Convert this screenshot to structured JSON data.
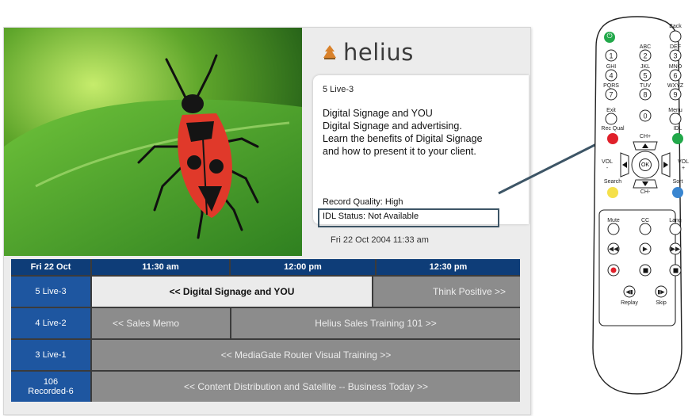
{
  "brand": {
    "name": "helius"
  },
  "info": {
    "channel": "5 Live-3",
    "description": "Digital Signage and YOU\nDigital Signage and advertising.\nLearn the benefits of Digital Signage\nand how to present it to your client.",
    "record_quality": "Record Quality: High",
    "idl_status": "IDL Status:  Not Available",
    "datetime": "Fri  22 Oct 2004  11:33 am"
  },
  "guide": {
    "header": [
      "Fri 22 Oct",
      "11:30 am",
      "12:00 pm",
      "12:30 pm"
    ],
    "rows": [
      {
        "channel": "5 Live-3",
        "programs": [
          "<< Digital Signage and YOU",
          "Think Positive >>"
        ]
      },
      {
        "channel": "4 Live-2",
        "programs": [
          "<< Sales Memo",
          "Helius Sales Training 101 >>"
        ]
      },
      {
        "channel": "3 Live-1",
        "programs": [
          "<< MediaGate Router Visual Training >>"
        ]
      },
      {
        "channel": "106\nRecorded-6",
        "programs": [
          "<< Content Distribution and Satellite --  Business Today >>"
        ]
      }
    ]
  },
  "remote": {
    "top_labels": {
      "back": "Back",
      "power_icon": "power-icon"
    },
    "number_pad": [
      {
        "num": "1",
        "letters": ""
      },
      {
        "num": "2",
        "letters": "ABC"
      },
      {
        "num": "3",
        "letters": "DEF"
      },
      {
        "num": "4",
        "letters": "GHI"
      },
      {
        "num": "5",
        "letters": "JKL"
      },
      {
        "num": "6",
        "letters": "MNO"
      },
      {
        "num": "7",
        "letters": "PQRS"
      },
      {
        "num": "8",
        "letters": "TUV"
      },
      {
        "num": "9",
        "letters": "WXYZ"
      },
      {
        "num": "0",
        "letters": ""
      }
    ],
    "labels": {
      "exit": "Exit",
      "menu": "Menu",
      "rec_qual": "Rec Qual",
      "idl": "IDL",
      "ch_up": "CH+",
      "ch_down": "CH-",
      "vol_down": "VOL\n-",
      "vol_up": "VOL\n+",
      "ok": "OK",
      "search": "Search",
      "sort": "Sort",
      "mute": "Mute",
      "cc": "CC",
      "lang": "Lang",
      "replay": "Replay",
      "skip": "Skip"
    },
    "colors": {
      "power": "#22a84a",
      "rec_qual": "#e0202a",
      "idl": "#22a84a",
      "search": "#f5e04a",
      "sort": "#3a86d0"
    }
  }
}
